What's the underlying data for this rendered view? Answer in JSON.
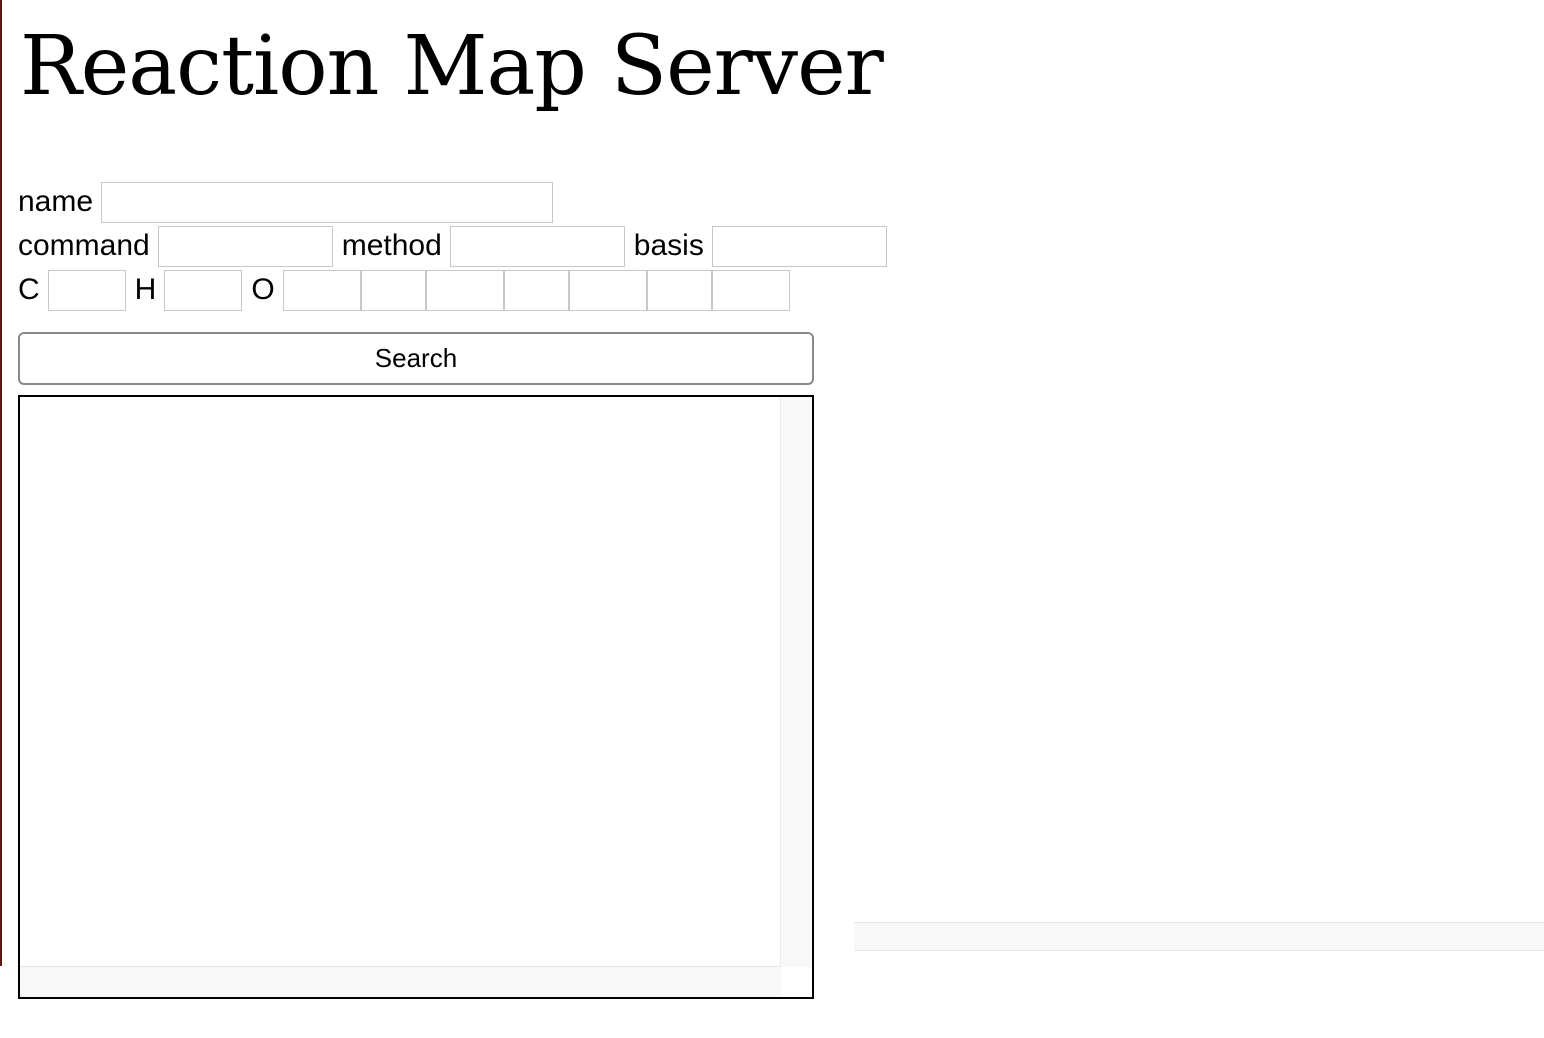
{
  "page": {
    "title": "Reaction Map Server"
  },
  "form": {
    "name_label": "name",
    "name_value": "",
    "command_label": "command",
    "command_value": "",
    "method_label": "method",
    "method_value": "",
    "basis_label": "basis",
    "basis_value": "",
    "atoms": [
      {
        "label": "C",
        "value": ""
      },
      {
        "label": "H",
        "value": ""
      },
      {
        "label": "O",
        "value": ""
      }
    ],
    "extra_pairs": [
      {
        "symbol": "",
        "count": ""
      },
      {
        "symbol": "",
        "count": ""
      },
      {
        "symbol": "",
        "count": ""
      }
    ]
  },
  "search": {
    "label": "Search"
  },
  "results": {
    "items": []
  },
  "colors": {
    "panel_border": "#000000",
    "input_border": "#c8c8c8",
    "button_border": "#8a8a8a",
    "scrollbar": "#f8f8f8"
  }
}
